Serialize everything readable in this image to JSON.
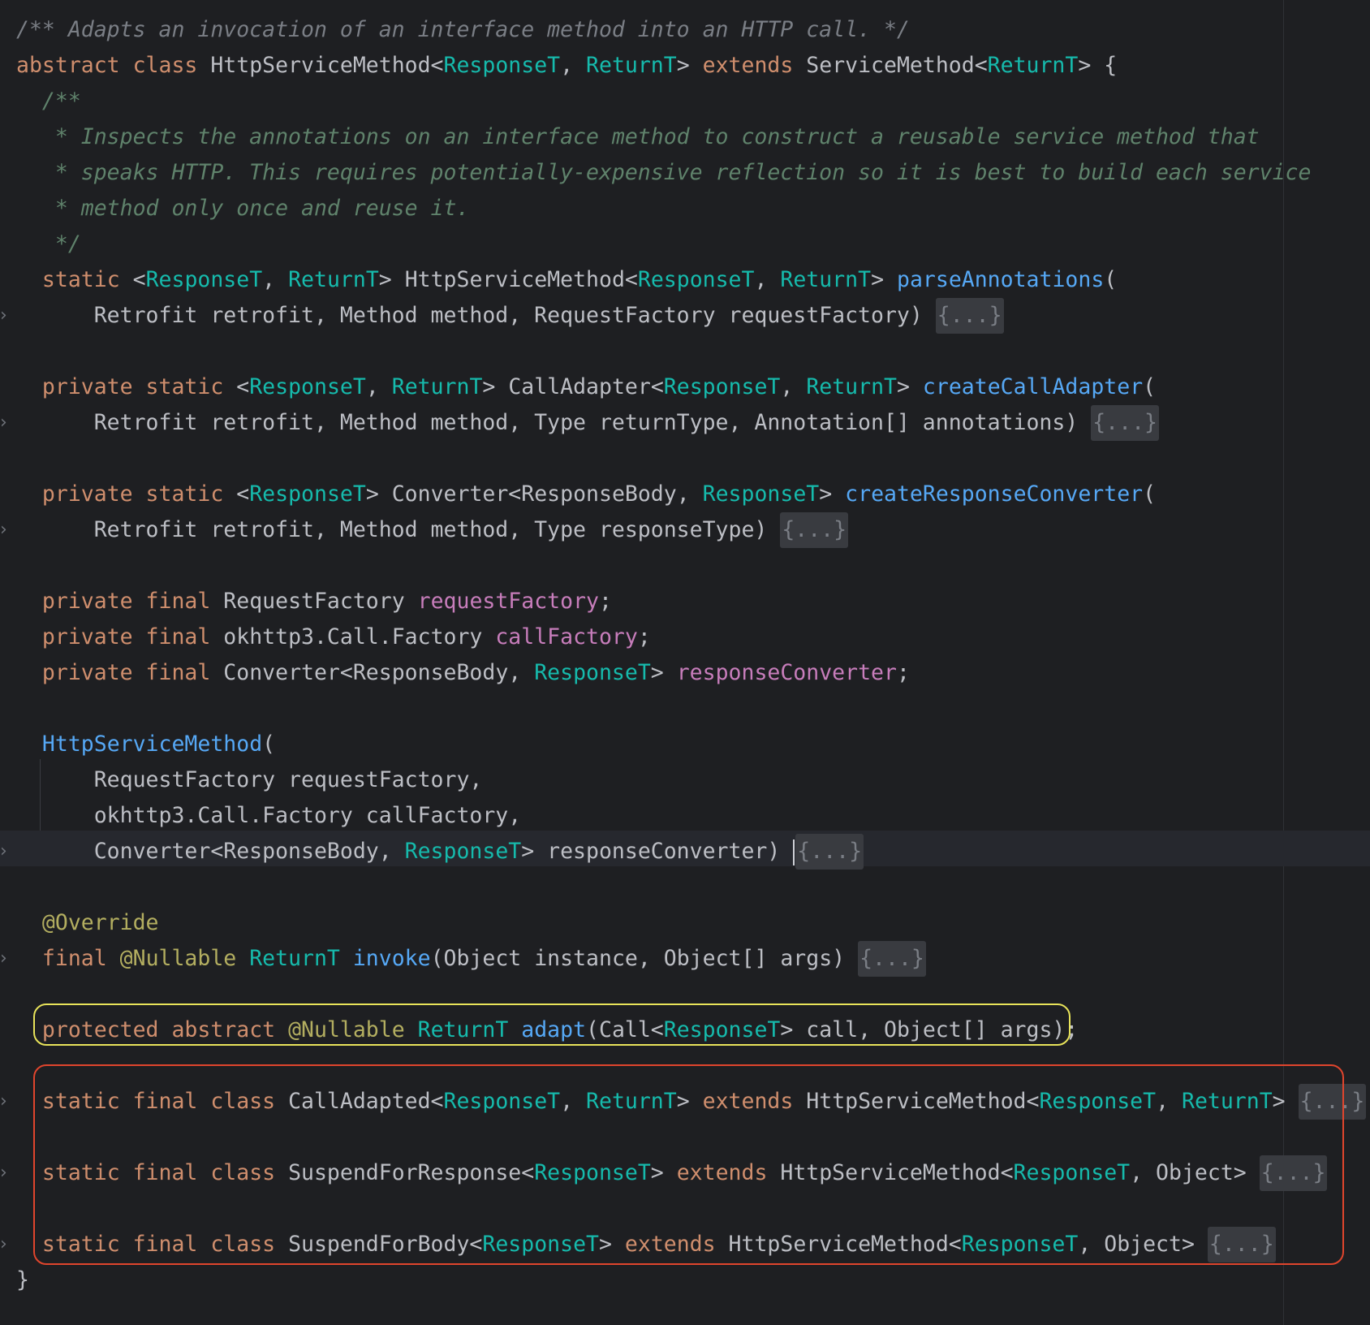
{
  "editor": {
    "language": "Java",
    "file_class": "HttpServiceMethod",
    "colors": {
      "background": "#1e1f22",
      "keyword": "#cf8e6d",
      "type_param": "#16baac",
      "method": "#56a8f5",
      "field": "#c77dbb",
      "annotation": "#b3ae60",
      "doc_comment": "#5f826b",
      "highlight_yellow": "#e8e35a",
      "highlight_red": "#e0452d"
    },
    "icons": {
      "fold_arrow": "chevron-right-icon"
    },
    "lines": [
      [
        [
          "c",
          "/** Adapts an invocation of an interface method into an HTTP call. */"
        ]
      ],
      [
        [
          "k",
          "abstract class "
        ],
        [
          "pl",
          "HttpServiceMethod<"
        ],
        [
          "tp",
          "ResponseT"
        ],
        [
          "pl",
          ", "
        ],
        [
          "tp",
          "ReturnT"
        ],
        [
          "pl",
          "> "
        ],
        [
          "k",
          "extends "
        ],
        [
          "pl",
          "ServiceMethod<"
        ],
        [
          "tp",
          "ReturnT"
        ],
        [
          "pl",
          "> {"
        ]
      ],
      [
        [
          "dc",
          "  /**"
        ]
      ],
      [
        [
          "dc",
          "   * Inspects the annotations on an interface method to construct a reusable service method that"
        ]
      ],
      [
        [
          "dc",
          "   * speaks HTTP. This requires potentially-expensive reflection so it is best to build each service"
        ]
      ],
      [
        [
          "dc",
          "   * method only once and reuse it."
        ]
      ],
      [
        [
          "dc",
          "   */"
        ]
      ],
      [
        [
          "pl",
          "  "
        ],
        [
          "k",
          "static "
        ],
        [
          "pl",
          "<"
        ],
        [
          "tp",
          "ResponseT"
        ],
        [
          "pl",
          ", "
        ],
        [
          "tp",
          "ReturnT"
        ],
        [
          "pl",
          "> HttpServiceMethod<"
        ],
        [
          "tp",
          "ResponseT"
        ],
        [
          "pl",
          ", "
        ],
        [
          "tp",
          "ReturnT"
        ],
        [
          "pl",
          "> "
        ],
        [
          "fn",
          "parseAnnotations"
        ],
        [
          "pl",
          "("
        ]
      ],
      [
        [
          "pl",
          "      Retrofit retrofit, Method method, RequestFactory requestFactory) "
        ],
        [
          "fold",
          "{...}"
        ]
      ],
      [],
      [
        [
          "pl",
          "  "
        ],
        [
          "k",
          "private static "
        ],
        [
          "pl",
          "<"
        ],
        [
          "tp",
          "ResponseT"
        ],
        [
          "pl",
          ", "
        ],
        [
          "tp",
          "ReturnT"
        ],
        [
          "pl",
          "> CallAdapter<"
        ],
        [
          "tp",
          "ResponseT"
        ],
        [
          "pl",
          ", "
        ],
        [
          "tp",
          "ReturnT"
        ],
        [
          "pl",
          "> "
        ],
        [
          "fn",
          "createCallAdapter"
        ],
        [
          "pl",
          "("
        ]
      ],
      [
        [
          "pl",
          "      Retrofit retrofit, Method method, Type returnType, Annotation[] annotations) "
        ],
        [
          "fold",
          "{...}"
        ]
      ],
      [],
      [
        [
          "pl",
          "  "
        ],
        [
          "k",
          "private static "
        ],
        [
          "pl",
          "<"
        ],
        [
          "tp",
          "ResponseT"
        ],
        [
          "pl",
          "> Converter<ResponseBody, "
        ],
        [
          "tp",
          "ResponseT"
        ],
        [
          "pl",
          "> "
        ],
        [
          "fn",
          "createResponseConverter"
        ],
        [
          "pl",
          "("
        ]
      ],
      [
        [
          "pl",
          "      Retrofit retrofit, Method method, Type responseType) "
        ],
        [
          "fold",
          "{...}"
        ]
      ],
      [],
      [
        [
          "pl",
          "  "
        ],
        [
          "k",
          "private final "
        ],
        [
          "pl",
          "RequestFactory "
        ],
        [
          "fd",
          "requestFactory"
        ],
        [
          "pl",
          ";"
        ]
      ],
      [
        [
          "pl",
          "  "
        ],
        [
          "k",
          "private final "
        ],
        [
          "pl",
          "okhttp3.Call.Factory "
        ],
        [
          "fd",
          "callFactory"
        ],
        [
          "pl",
          ";"
        ]
      ],
      [
        [
          "pl",
          "  "
        ],
        [
          "k",
          "private final "
        ],
        [
          "pl",
          "Converter<ResponseBody, "
        ],
        [
          "tp",
          "ResponseT"
        ],
        [
          "pl",
          "> "
        ],
        [
          "fd",
          "responseConverter"
        ],
        [
          "pl",
          ";"
        ]
      ],
      [],
      [
        [
          "pl",
          "  "
        ],
        [
          "fn",
          "HttpServiceMethod"
        ],
        [
          "pl",
          "("
        ]
      ],
      [
        [
          "pl",
          "      RequestFactory requestFactory,"
        ]
      ],
      [
        [
          "pl",
          "      okhttp3.Call.Factory callFactory,"
        ]
      ],
      [
        [
          "pl",
          "      Converter<ResponseBody, "
        ],
        [
          "tp",
          "ResponseT"
        ],
        [
          "pl",
          "> responseConverter) "
        ],
        [
          "caret",
          ""
        ],
        [
          "fold",
          "{...}"
        ]
      ],
      [],
      [
        [
          "pl",
          "  "
        ],
        [
          "an",
          "@Override"
        ]
      ],
      [
        [
          "pl",
          "  "
        ],
        [
          "k",
          "final "
        ],
        [
          "an",
          "@Nullable "
        ],
        [
          "tp",
          "ReturnT "
        ],
        [
          "fn",
          "invoke"
        ],
        [
          "pl",
          "(Object instance, Object[] args) "
        ],
        [
          "fold",
          "{...}"
        ]
      ],
      [],
      [
        [
          "pl",
          "  "
        ],
        [
          "k",
          "protected abstract "
        ],
        [
          "an",
          "@Nullable "
        ],
        [
          "tp",
          "ReturnT "
        ],
        [
          "fn",
          "adapt"
        ],
        [
          "pl",
          "(Call<"
        ],
        [
          "tp",
          "ResponseT"
        ],
        [
          "pl",
          "> call, Object[] args);"
        ]
      ],
      [],
      [
        [
          "pl",
          "  "
        ],
        [
          "k",
          "static final class "
        ],
        [
          "pl",
          "CallAdapted<"
        ],
        [
          "tp",
          "ResponseT"
        ],
        [
          "pl",
          ", "
        ],
        [
          "tp",
          "ReturnT"
        ],
        [
          "pl",
          "> "
        ],
        [
          "k",
          "extends "
        ],
        [
          "pl",
          "HttpServiceMethod<"
        ],
        [
          "tp",
          "ResponseT"
        ],
        [
          "pl",
          ", "
        ],
        [
          "tp",
          "ReturnT"
        ],
        [
          "pl",
          "> "
        ],
        [
          "fold",
          "{...}"
        ]
      ],
      [],
      [
        [
          "pl",
          "  "
        ],
        [
          "k",
          "static final class "
        ],
        [
          "pl",
          "SuspendForResponse<"
        ],
        [
          "tp",
          "ResponseT"
        ],
        [
          "pl",
          "> "
        ],
        [
          "k",
          "extends "
        ],
        [
          "pl",
          "HttpServiceMethod<"
        ],
        [
          "tp",
          "ResponseT"
        ],
        [
          "pl",
          ", Object> "
        ],
        [
          "fold",
          "{...}"
        ]
      ],
      [],
      [
        [
          "pl",
          "  "
        ],
        [
          "k",
          "static final class "
        ],
        [
          "pl",
          "SuspendForBody<"
        ],
        [
          "tp",
          "ResponseT"
        ],
        [
          "pl",
          "> "
        ],
        [
          "k",
          "extends "
        ],
        [
          "pl",
          "HttpServiceMethod<"
        ],
        [
          "tp",
          "ResponseT"
        ],
        [
          "pl",
          ", Object> "
        ],
        [
          "fold",
          "{...}"
        ]
      ],
      [
        [
          "pl",
          "}"
        ]
      ]
    ],
    "fold_marker_lines": [
      8,
      11,
      14,
      23,
      26,
      30,
      32,
      34
    ],
    "caret_line": 23,
    "highlight_yellow_line": 28,
    "highlight_red_lines": [
      30,
      34
    ]
  }
}
